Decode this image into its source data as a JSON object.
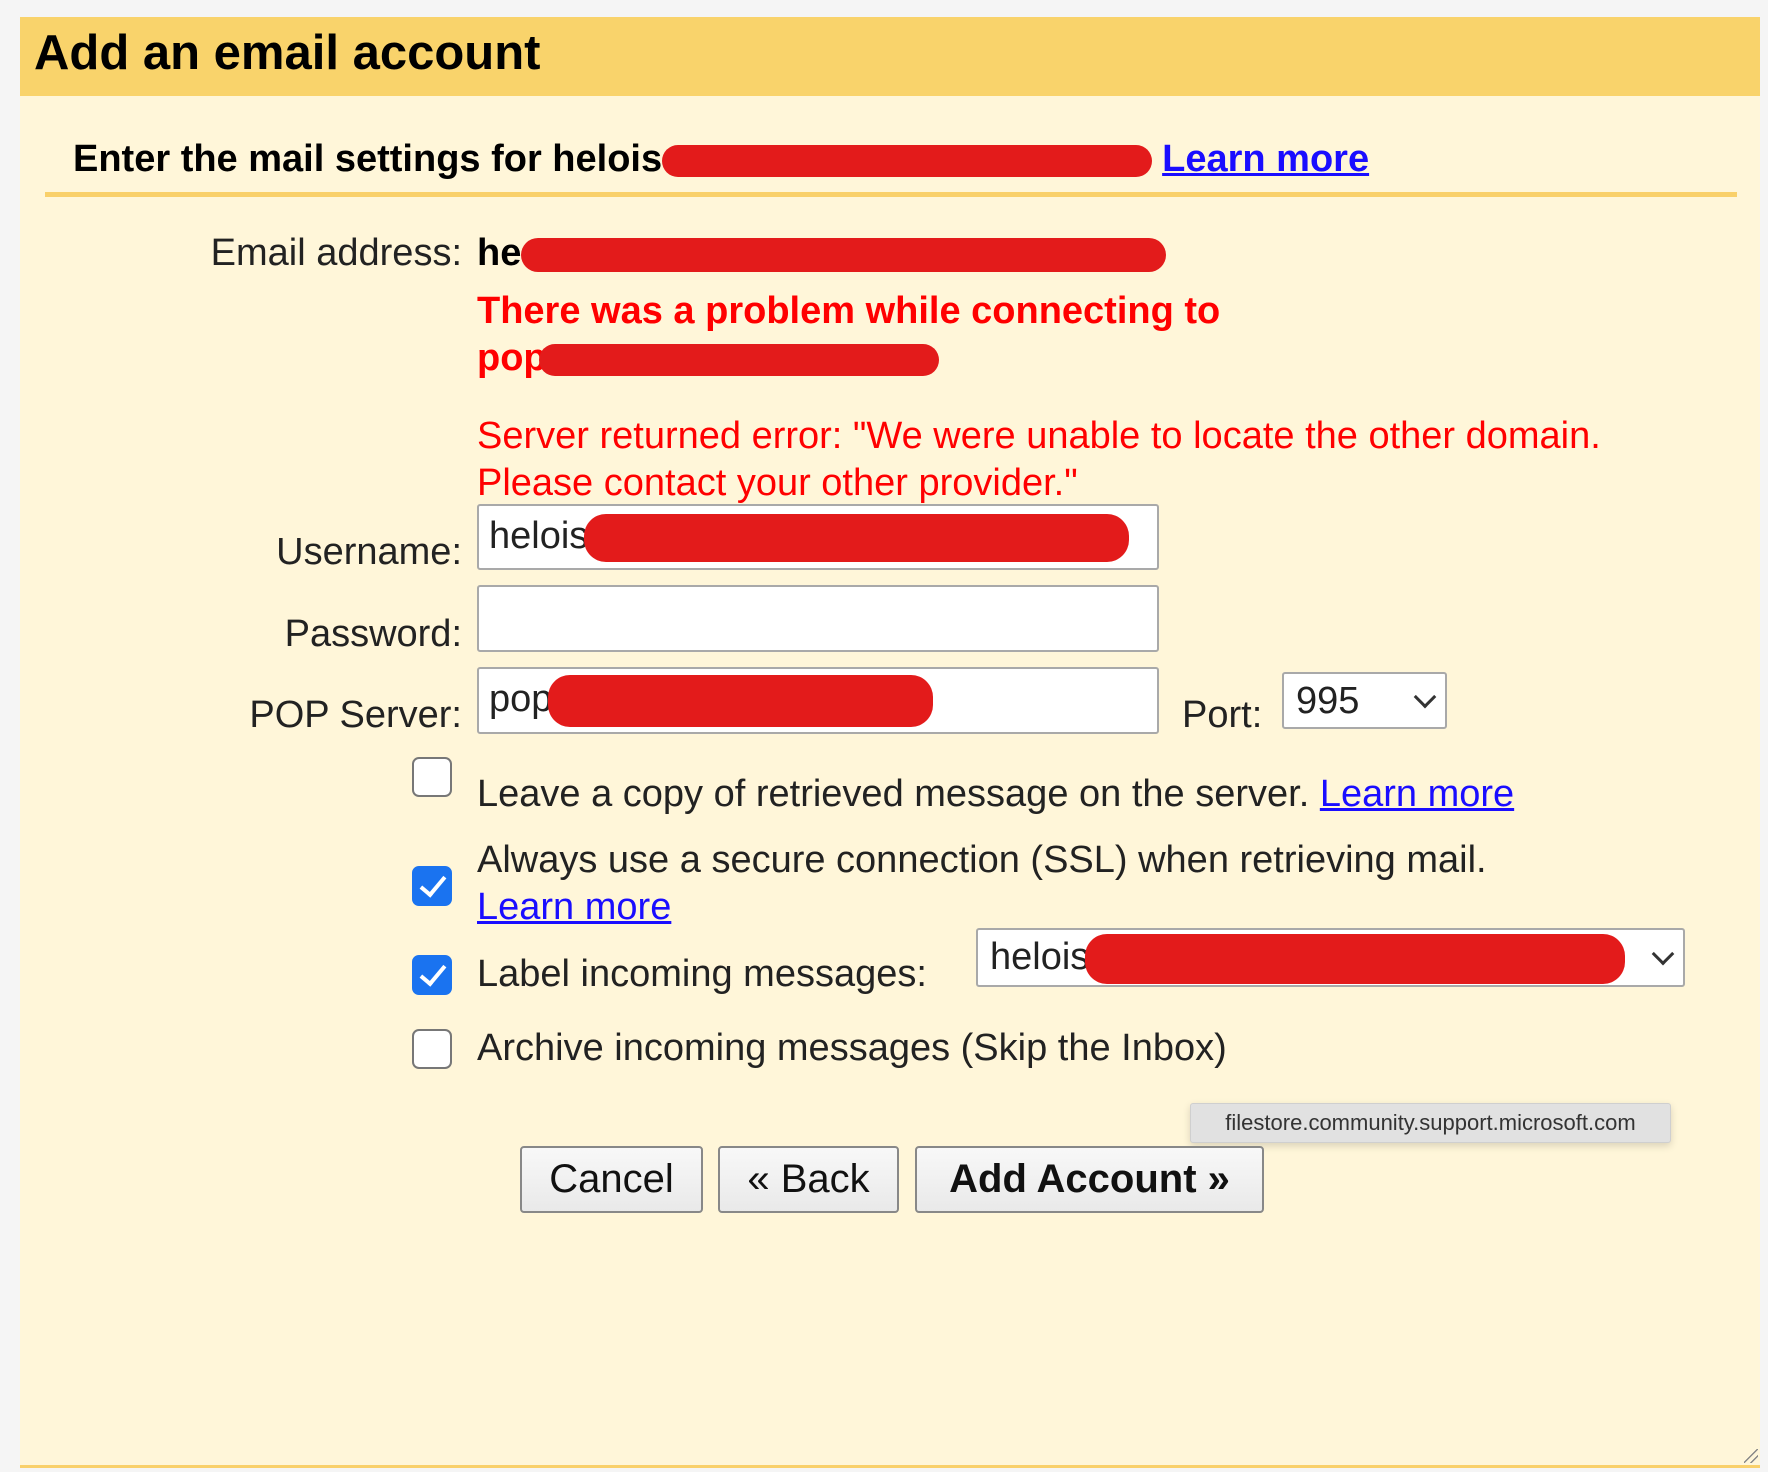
{
  "dialog": {
    "title": "Add an email account",
    "subtitle_prefix": "Enter the mail settings for helois",
    "subtitle_learn_more": "Learn more"
  },
  "form": {
    "email_label": "Email address:",
    "email_value_visible": "he",
    "error_title_line1": "There was a problem while connecting to",
    "error_title_line2_visible": "pop",
    "error_detail_line1": "Server returned error: \"We were unable to locate the other domain.",
    "error_detail_line2": "Please contact your other provider.\"",
    "username_label": "Username:",
    "username_value_visible": "helois",
    "password_label": "Password:",
    "password_value": "",
    "pop_server_label": "POP Server:",
    "pop_server_value_visible": "pop",
    "port_label": "Port:",
    "port_value": "995",
    "leave_copy_label": "Leave a copy of retrieved message on the server.",
    "leave_copy_checked": false,
    "leave_copy_learn_more": "Learn more",
    "ssl_label": "Always use a secure connection (SSL) when retrieving mail.",
    "ssl_checked": true,
    "ssl_learn_more": "Learn more",
    "label_incoming_label": "Label incoming messages:",
    "label_incoming_checked": true,
    "label_incoming_value_visible": "helois",
    "archive_label": "Archive incoming messages (Skip the Inbox)",
    "archive_checked": false
  },
  "buttons": {
    "cancel": "Cancel",
    "back": "« Back",
    "add_account": "Add Account »"
  },
  "tooltip": "filestore.community.support.microsoft.com",
  "colors": {
    "header": "#f9d36b",
    "background": "#fff6d9",
    "error": "#ff0000",
    "link": "#1a0dff",
    "redaction": "#e31b1b",
    "checkbox_checked": "#1a73f0"
  }
}
